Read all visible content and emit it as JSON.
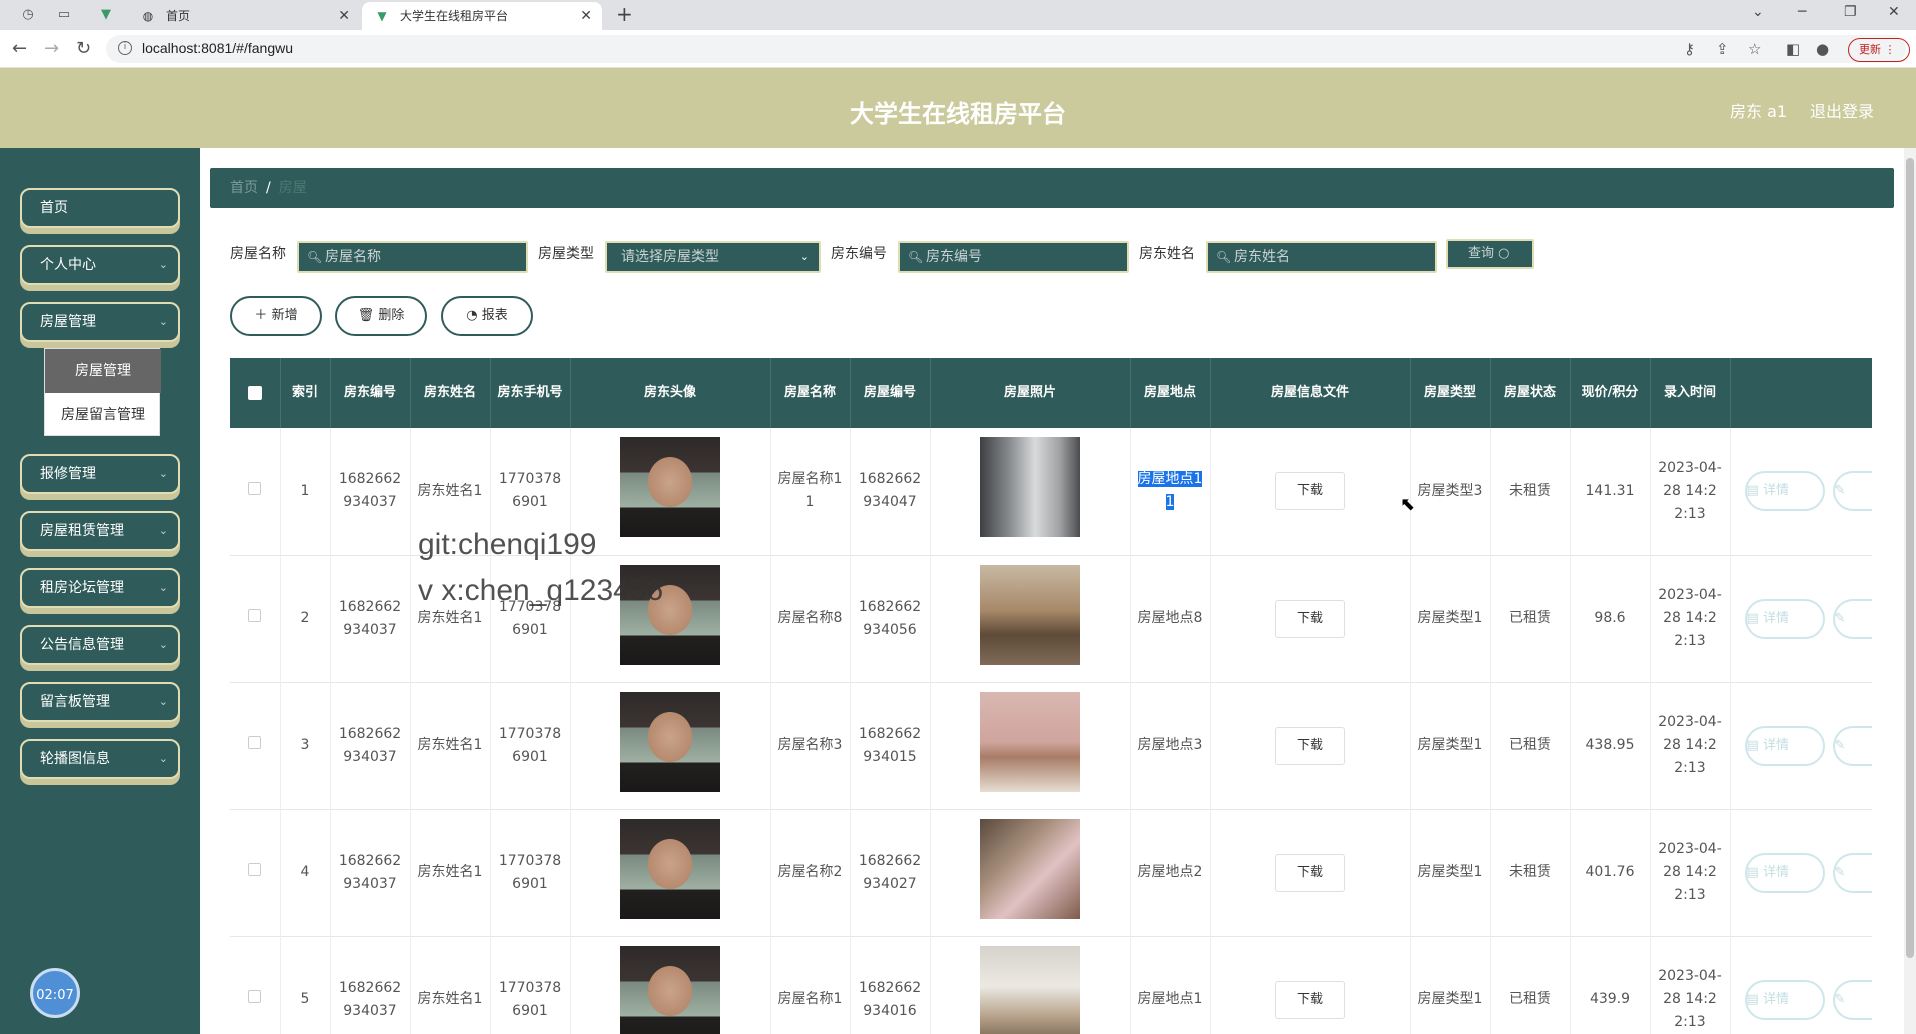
{
  "browser": {
    "tabs": [
      {
        "label": "首页"
      },
      {
        "label": "大学生在线租房平台"
      }
    ],
    "url": "localhost:8081/#/fangwu",
    "update_label": "更新"
  },
  "header": {
    "title": "大学生在线租房平台",
    "user": "房东 a1",
    "logout": "退出登录"
  },
  "sidebar": {
    "items": [
      {
        "label": "首页"
      },
      {
        "label": "个人中心"
      },
      {
        "label": "房屋管理"
      },
      {
        "label": "报修管理"
      },
      {
        "label": "房屋租赁管理"
      },
      {
        "label": "租房论坛管理"
      },
      {
        "label": "公告信息管理"
      },
      {
        "label": "留言板管理"
      },
      {
        "label": "轮播图信息"
      }
    ],
    "submenu": [
      {
        "label": "房屋管理"
      },
      {
        "label": "房屋留言管理"
      }
    ],
    "clock": "02:07"
  },
  "breadcrumb": {
    "home": "首页",
    "sep": "/",
    "current": "房屋"
  },
  "search": {
    "fields": [
      {
        "label": "房屋名称",
        "placeholder": "房屋名称"
      },
      {
        "label": "房屋类型",
        "placeholder": "请选择房屋类型"
      },
      {
        "label": "房东编号",
        "placeholder": "房东编号"
      },
      {
        "label": "房东姓名",
        "placeholder": "房东姓名"
      }
    ],
    "query_label": "查询"
  },
  "actions": {
    "add": "新增",
    "delete": "删除",
    "report": "报表"
  },
  "table": {
    "columns": [
      "索引",
      "房东编号",
      "房东姓名",
      "房东手机号",
      "房东头像",
      "房屋名称",
      "房屋编号",
      "房屋照片",
      "房屋地点",
      "房屋信息文件",
      "房屋类型",
      "房屋状态",
      "现价/积分",
      "录入时间"
    ],
    "download_label": "下载",
    "detail_label": "详情",
    "rows": [
      {
        "index": "1",
        "owner_id": "1682662934037",
        "owner_name": "房东姓名1",
        "phone": "17703786901",
        "house_name": "房屋名称11",
        "house_id": "1682662934047",
        "location": "房屋地点11",
        "type": "房屋类型3",
        "status": "未租赁",
        "price": "141.31",
        "time": "2023-04-28 14:22:13"
      },
      {
        "index": "2",
        "owner_id": "1682662934037",
        "owner_name": "房东姓名1",
        "phone": "17703786901",
        "house_name": "房屋名称8",
        "house_id": "1682662934056",
        "location": "房屋地点8",
        "type": "房屋类型1",
        "status": "已租赁",
        "price": "98.6",
        "time": "2023-04-28 14:22:13"
      },
      {
        "index": "3",
        "owner_id": "1682662934037",
        "owner_name": "房东姓名1",
        "phone": "17703786901",
        "house_name": "房屋名称3",
        "house_id": "1682662934015",
        "location": "房屋地点3",
        "type": "房屋类型1",
        "status": "已租赁",
        "price": "438.95",
        "time": "2023-04-28 14:22:13"
      },
      {
        "index": "4",
        "owner_id": "1682662934037",
        "owner_name": "房东姓名1",
        "phone": "17703786901",
        "house_name": "房屋名称2",
        "house_id": "1682662934027",
        "location": "房屋地点2",
        "type": "房屋类型1",
        "status": "未租赁",
        "price": "401.76",
        "time": "2023-04-28 14:22:13"
      },
      {
        "index": "5",
        "owner_id": "1682662934037",
        "owner_name": "房东姓名1",
        "phone": "17703786901",
        "house_name": "房屋名称1",
        "house_id": "1682662934016",
        "location": "房屋地点1",
        "type": "房屋类型1",
        "status": "已租赁",
        "price": "439.9",
        "time": "2023-04-28 14:22:13"
      }
    ]
  },
  "watermark": {
    "line1": "git:chenqi199",
    "line2": "v x:chen_q123456"
  }
}
